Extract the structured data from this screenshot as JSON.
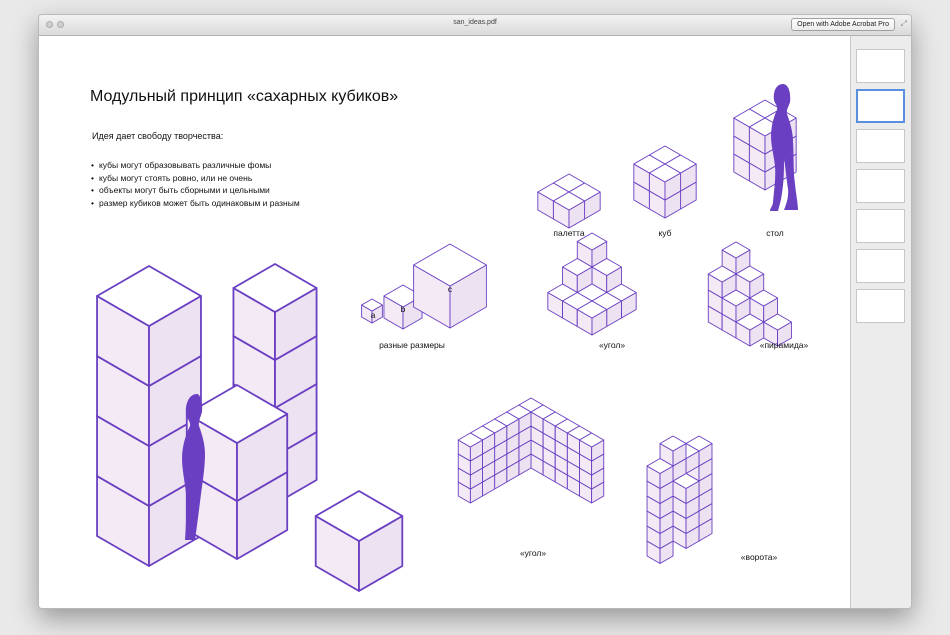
{
  "window": {
    "filename": "san_ideas.pdf",
    "open_button": "Open with Adobe Acrobat Pro",
    "fullscreen_icon": "fullscreen-icon"
  },
  "slide": {
    "title": "Модульный принцип «сахарных кубиков»",
    "intro": "Идея дает свободу творчества:",
    "bullets": [
      "кубы могут образовывать различные фомы",
      "кубы могут стоять ровно, или не очень",
      "объекты могут быть сборными и цельными",
      "размер кубиков может быть одинаковым и разным"
    ]
  },
  "captions": {
    "palette": "палетта",
    "cube": "куб",
    "table": "стол",
    "sizes": "разные размеры",
    "corner_small": "«угол»",
    "pyramid": "«пирамида»",
    "corner_large": "«угол»",
    "gate": "«ворота»",
    "size_a": "a",
    "size_b": "b",
    "size_c": "c"
  },
  "thumbnails": {
    "count": 7,
    "selected_index": 1
  },
  "colors": {
    "accent": "#6a3fc2",
    "figure": "#6a3fc2",
    "cube_face": "#f1e8f5",
    "selection": "#5a8fe0"
  }
}
